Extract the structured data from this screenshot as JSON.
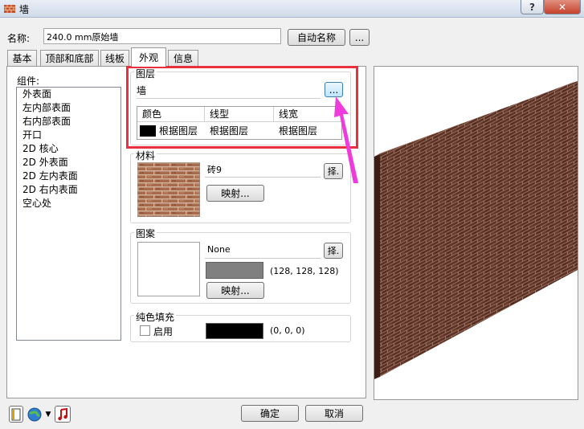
{
  "window": {
    "title": "墙",
    "help_label": "?",
    "close_label": "✕"
  },
  "name_row": {
    "label": "名称:",
    "value": "240.0 mm原始墙",
    "auto_name_button": "自动名称",
    "more_button": "..."
  },
  "tabs": [
    {
      "label": "基本"
    },
    {
      "label": "顶部和底部"
    },
    {
      "label": "线板"
    },
    {
      "label": "外观",
      "active": true
    },
    {
      "label": "信息"
    }
  ],
  "components": {
    "label": "组件:",
    "items": [
      "外表面",
      "左内部表面",
      "右内部表面",
      "开口",
      "2D 核心",
      "2D 外表面",
      "2D 左内表面",
      "2D 右内表面",
      "空心处"
    ]
  },
  "layer": {
    "title": "图层",
    "value": "墙",
    "browse_button": "...",
    "table": {
      "headers": [
        "颜色",
        "线型",
        "线宽"
      ],
      "row": [
        "根据图层",
        "根据图层",
        "根据图层"
      ],
      "swatch_color": "#000000"
    }
  },
  "material": {
    "title": "材料",
    "name": "砖9",
    "select_button": "择.",
    "map_button": "映射..."
  },
  "pattern": {
    "title": "图案",
    "name": "None",
    "select_button": "择.",
    "swatch_color": "#808080",
    "color_text": "(128, 128, 128)",
    "map_button": "映射..."
  },
  "solid_fill": {
    "title": "纯色填充",
    "checkbox_label": "启用",
    "checked": false,
    "swatch_color": "#000000",
    "color_text": "(0, 0, 0)"
  },
  "footer": {
    "ok_button": "确定",
    "cancel_button": "取消"
  },
  "colors": {
    "highlight": "#e8303f",
    "arrow": "#ee3bdc",
    "brick": "#5a3024"
  }
}
